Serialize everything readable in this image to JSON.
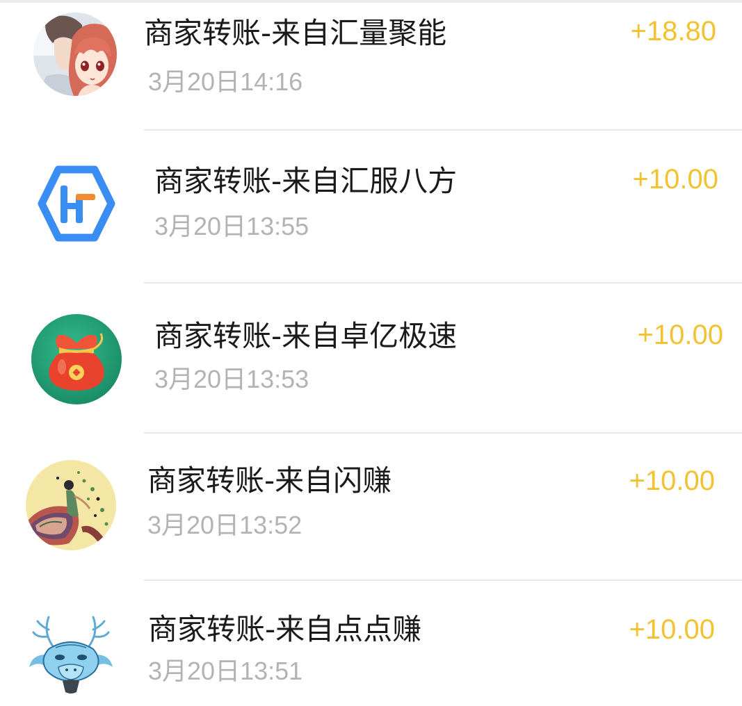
{
  "transactions": [
    {
      "title": "商家转账-来自汇量聚能",
      "time": "3月20日14:16",
      "amount": "+18.80",
      "avatar_icon": "anime-couple-avatar-icon"
    },
    {
      "title": "商家转账-来自汇服八方",
      "time": "3月20日13:55",
      "amount": "+10.00",
      "avatar_icon": "hf-logo-avatar-icon",
      "avatar_logo_text": "HF"
    },
    {
      "title": "商家转账-来自卓亿极速",
      "time": "3月20日13:53",
      "amount": "+10.00",
      "avatar_icon": "money-bag-avatar-icon"
    },
    {
      "title": "商家转账-来自闪赚",
      "time": "3月20日13:52",
      "amount": "+10.00",
      "avatar_icon": "illustration-avatar-icon"
    },
    {
      "title": "商家转账-来自点点赚",
      "time": "3月20日13:51",
      "amount": "+10.00",
      "avatar_icon": "dragon-avatar-icon"
    }
  ],
  "colors": {
    "amount": "#F2C230",
    "title": "#1A1A1A",
    "time": "#B3B3B3",
    "divider": "#E8E8E8",
    "top_line": "#EBEBEB",
    "background": "#FFFFFF"
  }
}
